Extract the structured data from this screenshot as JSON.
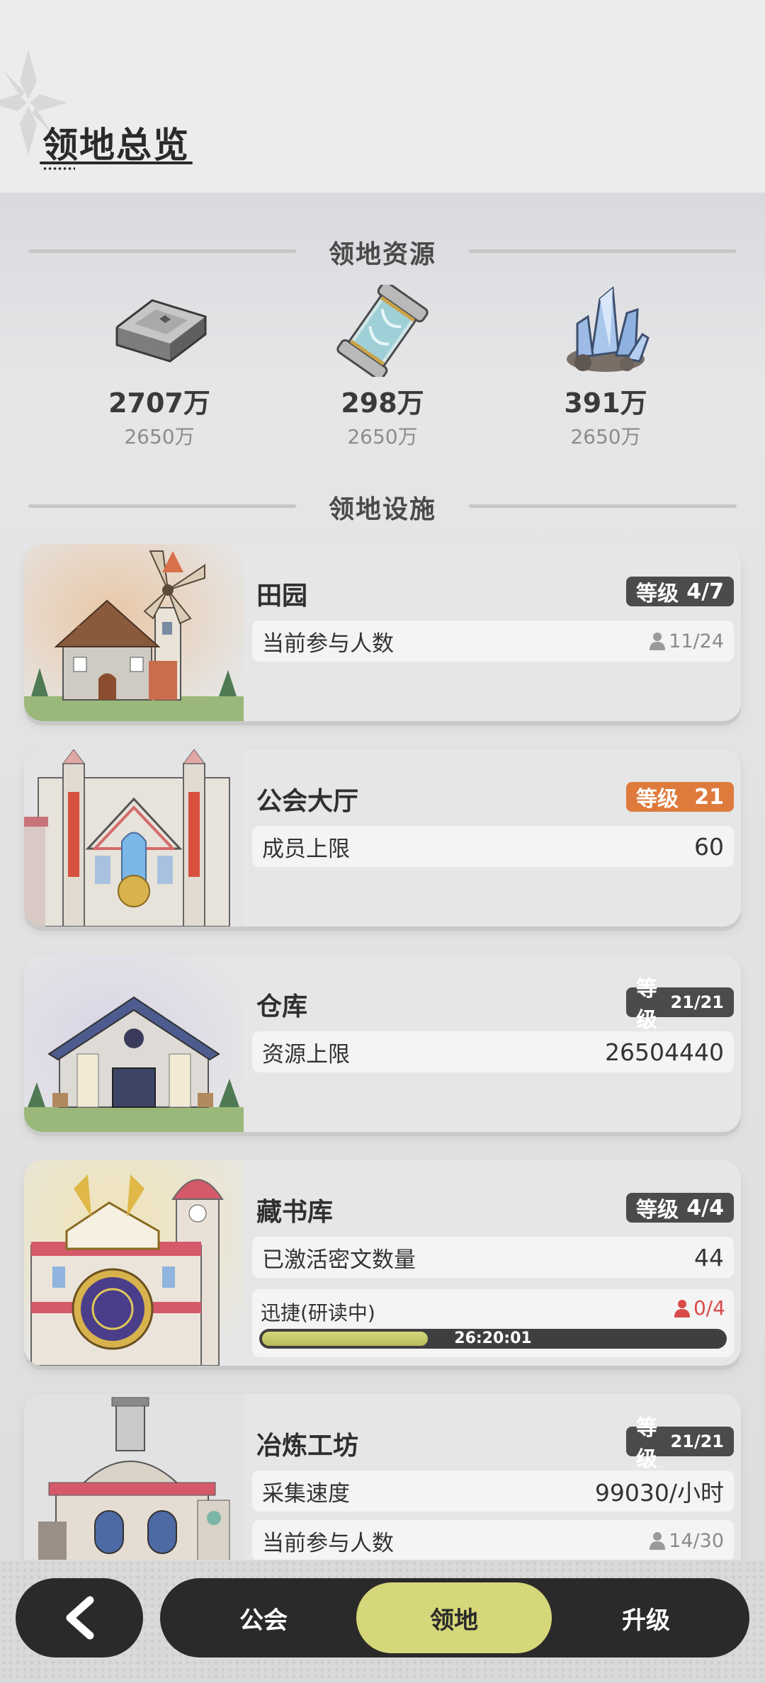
{
  "header": {
    "title": "领地总览"
  },
  "resources_section": {
    "title": "领地资源",
    "items": [
      {
        "icon": "iron-ingot-icon",
        "amount": "2707万",
        "cap": "2650万"
      },
      {
        "icon": "scroll-canister-icon",
        "amount": "298万",
        "cap": "2650万"
      },
      {
        "icon": "crystal-ore-icon",
        "amount": "391万",
        "cap": "2650万"
      }
    ]
  },
  "facilities_section": {
    "title": "领地设施",
    "cards": [
      {
        "name": "田园",
        "level_label": "等级",
        "level_value": "4/7",
        "rows": [
          {
            "label": "当前参与人数",
            "value": "11/24"
          }
        ]
      },
      {
        "name": "公会大厅",
        "level_label": "等级",
        "level_value": "21",
        "rows": [
          {
            "label": "成员上限",
            "value": "60"
          }
        ]
      },
      {
        "name": "仓库",
        "level_label": "等级",
        "level_value": "21/21",
        "rows": [
          {
            "label": "资源上限",
            "value": "26504440"
          }
        ]
      },
      {
        "name": "藏书库",
        "level_label": "等级",
        "level_value": "4/4",
        "rows": [
          {
            "label": "已激活密文数量",
            "value": "44"
          }
        ],
        "research": {
          "label": "迅捷(研读中)",
          "participants": "0/4",
          "time": "26:20:01",
          "progress": 0.36
        }
      },
      {
        "name": "冶炼工坊",
        "level_label": "等级",
        "level_value": "21/21",
        "rows": [
          {
            "label": "采集速度",
            "value": "99030/小时"
          },
          {
            "label": "当前参与人数",
            "value": "14/30"
          }
        ]
      }
    ]
  },
  "nav": {
    "tabs": [
      {
        "label": "公会",
        "active": false
      },
      {
        "label": "领地",
        "active": true
      },
      {
        "label": "升级",
        "active": false
      }
    ]
  },
  "colors": {
    "accent": "#d6d67a",
    "badge_dark": "#4b4b4b",
    "badge_orange": "#de7a3c",
    "alert_red": "#d84a4a"
  }
}
